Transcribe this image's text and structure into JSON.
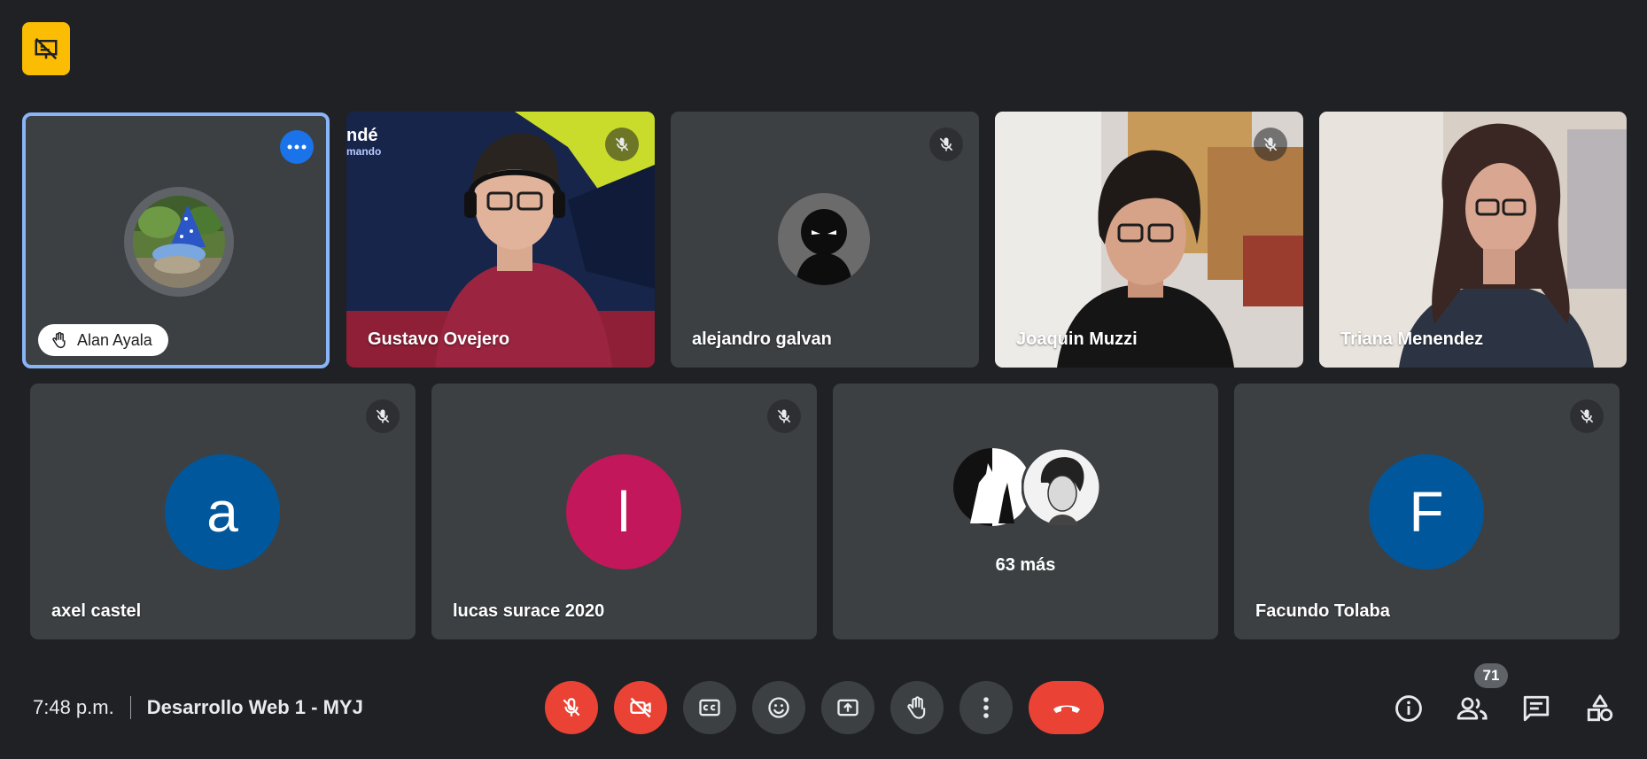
{
  "participants_top": [
    {
      "name": "Alan Ayala",
      "hand_raised": true,
      "pinned_selected": true
    },
    {
      "name": "Gustavo Ovejero",
      "mic_muted": true
    },
    {
      "name": "alejandro galvan",
      "mic_muted": true
    },
    {
      "name": "Joaquin Muzzi",
      "mic_muted": true
    },
    {
      "name": "Triana Menendez",
      "mic_muted": true
    }
  ],
  "participants_bottom": [
    {
      "name": "axel castel",
      "initial": "a",
      "avatar_color": "#01579b",
      "mic_muted": true
    },
    {
      "name": "lucas surace 2020",
      "initial": "l",
      "avatar_color": "#c2185b",
      "mic_muted": true
    },
    {
      "more_label": "63 más"
    },
    {
      "name": "Facundo Tolaba",
      "initial": "F",
      "avatar_color": "#01579b",
      "mic_muted": true
    }
  ],
  "background_partial_text": {
    "line1": "ndé",
    "line2": "mando"
  },
  "meeting": {
    "time": "7:48 p.m.",
    "title": "Desarrollo Web 1 - MYJ"
  },
  "people_count": "71",
  "colors": {
    "background": "#202124",
    "tile": "#3c4043",
    "danger": "#ea4335",
    "accent": "#8ab4f8",
    "options_button": "#1a73e8",
    "warning": "#fbbc04"
  },
  "icons": {
    "warning_badge": "presentation-off-icon",
    "controls": [
      "mic-off-icon",
      "camera-off-icon",
      "captions-icon",
      "emoji-icon",
      "present-icon",
      "raise-hand-icon",
      "more-options-icon",
      "end-call-icon"
    ],
    "side": [
      "info-icon",
      "people-icon",
      "chat-icon",
      "activities-icon"
    ]
  }
}
